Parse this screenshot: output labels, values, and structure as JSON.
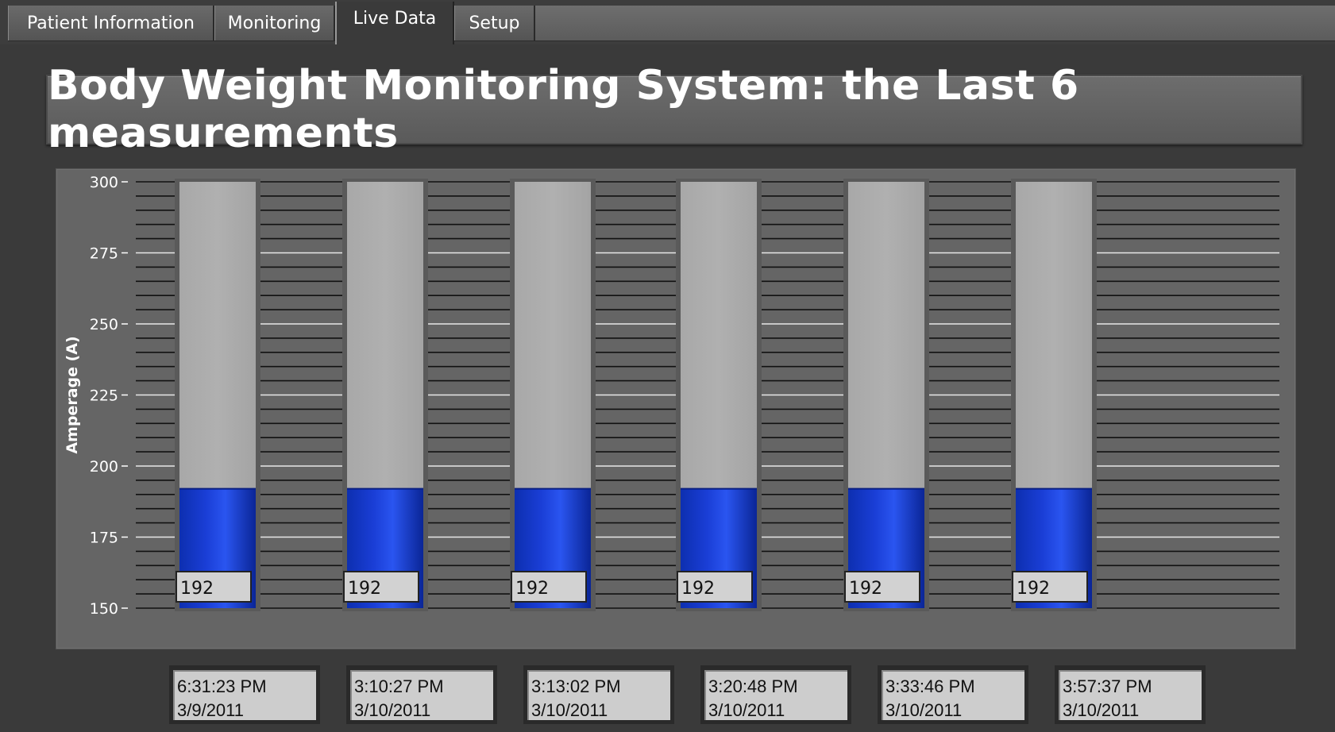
{
  "tabs": [
    {
      "label": "Patient Information",
      "active": false
    },
    {
      "label": "Monitoring",
      "active": false
    },
    {
      "label": "Live Data",
      "active": true
    },
    {
      "label": "Setup",
      "active": false
    }
  ],
  "title": "Body Weight Monitoring System: the Last 6 measurements",
  "chart_data": {
    "type": "bar",
    "ylabel": "Amperage (A)",
    "ylim": [
      150,
      300
    ],
    "yticks": [
      150,
      175,
      200,
      225,
      250,
      275,
      300
    ],
    "categories": [
      "6:31:23 PM 3/9/2011",
      "3:10:27 PM 3/10/2011",
      "3:13:02 PM 3/10/2011",
      "3:20:48 PM 3/10/2011",
      "3:33:46 PM 3/10/2011",
      "3:57:37 PM 3/10/2011"
    ],
    "values": [
      192,
      192,
      192,
      192,
      192,
      192
    ],
    "bar_color": "#1a3ed6",
    "track_color": "#b0b0b0",
    "grid": true
  },
  "timestamps": [
    {
      "time": "6:31:23 PM",
      "date": "3/9/2011"
    },
    {
      "time": "3:10:27 PM",
      "date": "3/10/2011"
    },
    {
      "time": "3:13:02 PM",
      "date": "3/10/2011"
    },
    {
      "time": "3:20:48 PM",
      "date": "3/10/2011"
    },
    {
      "time": "3:33:46 PM",
      "date": "3/10/2011"
    },
    {
      "time": "3:57:37 PM",
      "date": "3/10/2011"
    }
  ]
}
